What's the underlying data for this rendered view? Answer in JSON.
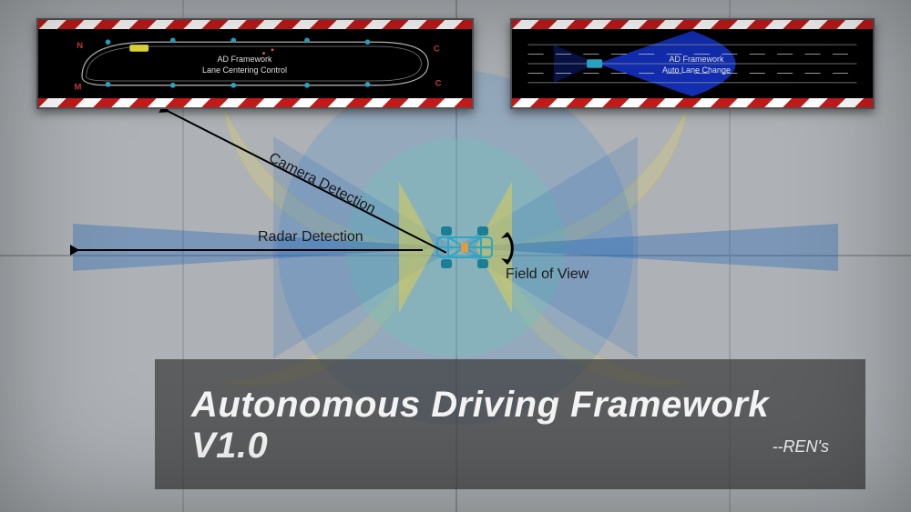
{
  "panels": {
    "left": {
      "title": "AD Framework",
      "subtitle": "Lane Centering Control"
    },
    "right": {
      "title": "AD Framework",
      "subtitle": "Auto Lane Change"
    }
  },
  "annotations": {
    "camera": "Camera Detection",
    "radar": "Radar Detection",
    "fov": "Field of View"
  },
  "titlecard": {
    "headline": "Autonomous Driving Framework V1.0",
    "byline": "--REN's"
  },
  "colors": {
    "title_bg": "#3c3c3cB8",
    "title_text": "#f5f5f5",
    "anno_text": "#1a1a1a",
    "cone_blue": "#3e88d8",
    "cone_yellow": "#e7d770",
    "cone_teal": "#6fc3b8"
  }
}
